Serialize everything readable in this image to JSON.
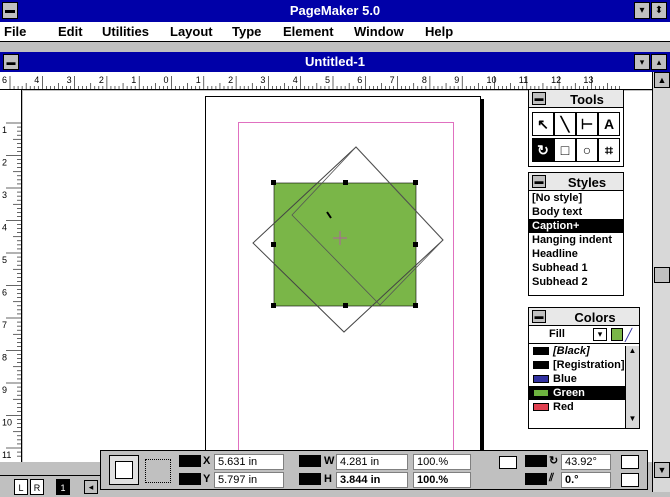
{
  "app": {
    "title": "PageMaker 5.0",
    "document_title": "Untitled-1"
  },
  "menu": [
    "File",
    "Edit",
    "Utilities",
    "Layout",
    "Type",
    "Element",
    "Window",
    "Help"
  ],
  "ruler": {
    "top_labels": [
      "6",
      "4",
      "3",
      "2",
      "1",
      "0",
      "1",
      "2",
      "3",
      "4",
      "5",
      "6",
      "7",
      "8",
      "9",
      "10",
      "11",
      "12",
      "13"
    ],
    "left_labels": [
      "1",
      "2",
      "3",
      "4",
      "5",
      "6",
      "7",
      "8",
      "9",
      "10",
      "11"
    ]
  },
  "tools": {
    "title": "Tools",
    "items": [
      "pointer-icon",
      "line-icon",
      "constrained-line-icon",
      "text-icon",
      "rotate-icon",
      "rectangle-icon",
      "ellipse-icon",
      "crop-icon"
    ],
    "glyphs": [
      "↖",
      "╲",
      "⊢",
      "A",
      "↻",
      "□",
      "○",
      "⌗"
    ]
  },
  "styles": {
    "title": "Styles",
    "items": [
      "[No style]",
      "Body text",
      "Caption+",
      "Hanging indent",
      "Headline",
      "Subhead 1",
      "Subhead 2"
    ],
    "selected_index": 2
  },
  "colors": {
    "title": "Colors",
    "fill_label": "Fill",
    "items": [
      {
        "name": "[Black]",
        "swatch": "#000000"
      },
      {
        "name": "[Registration]",
        "swatch": "#000000"
      },
      {
        "name": "Blue",
        "swatch": "#3030a0"
      },
      {
        "name": "Green",
        "swatch": "#6db33f"
      },
      {
        "name": "Red",
        "swatch": "#e04050"
      }
    ],
    "selected_index": 3
  },
  "control_palette": {
    "x_label": "X",
    "x_value": "5.631 in",
    "y_label": "Y",
    "y_value": "5.797 in",
    "w_label": "W",
    "w_value": "4.281 in",
    "h_label": "H",
    "h_value": "3.844 in",
    "scale_w": "100.%",
    "scale_h": "100.%",
    "rotation_value": "43.92°",
    "skew_value": "0.°"
  },
  "bottom": {
    "master_left": "L",
    "master_right": "R",
    "page_number": "1"
  },
  "colors_theme": {
    "titlebar": "#0000a8",
    "object_fill": "#7ab648"
  }
}
